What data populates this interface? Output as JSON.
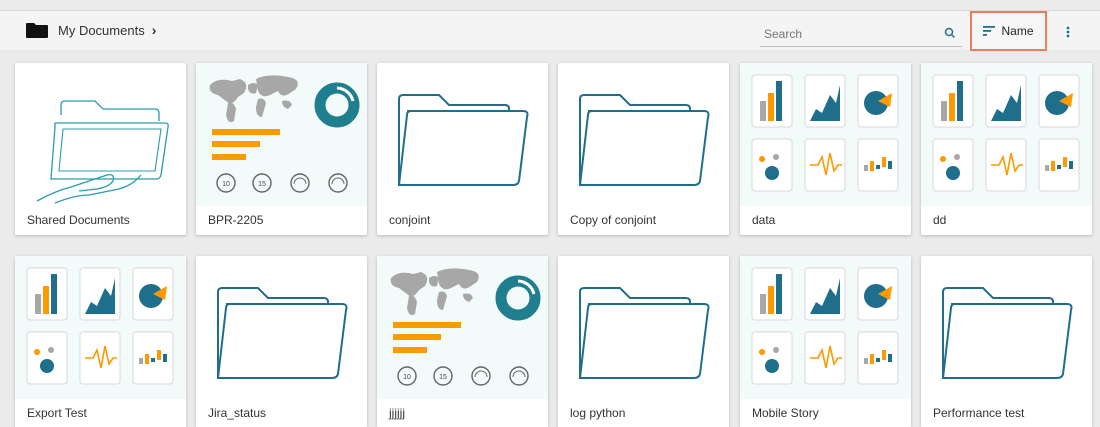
{
  "breadcrumb": {
    "label": "My Documents",
    "chevron": "›"
  },
  "search": {
    "placeholder": "Search",
    "value": ""
  },
  "sort": {
    "label": "Name",
    "active_border_color": "#ef7c5a"
  },
  "colors": {
    "accent_teal": "#1f6e8c",
    "accent_orange": "#ff9900",
    "thumb_bg": "#f3fafa"
  },
  "items": [
    {
      "name": "Shared Documents",
      "icon": "shared-folder-icon"
    },
    {
      "name": "BPR-2205",
      "icon": "dashboard-icon"
    },
    {
      "name": "conjoint",
      "icon": "folder-icon"
    },
    {
      "name": "Copy of conjoint",
      "icon": "folder-icon"
    },
    {
      "name": "data",
      "icon": "story-charts-icon"
    },
    {
      "name": "dd",
      "icon": "story-charts-icon"
    },
    {
      "name": "Export Test",
      "icon": "story-charts-icon"
    },
    {
      "name": "Jira_status",
      "icon": "folder-icon"
    },
    {
      "name": "jjjjjj",
      "icon": "dashboard-icon"
    },
    {
      "name": "log python",
      "icon": "folder-icon"
    },
    {
      "name": "Mobile Story",
      "icon": "story-charts-icon"
    },
    {
      "name": "Performance test",
      "icon": "folder-icon"
    }
  ],
  "dashboard_gauges": [
    "10",
    "15"
  ]
}
